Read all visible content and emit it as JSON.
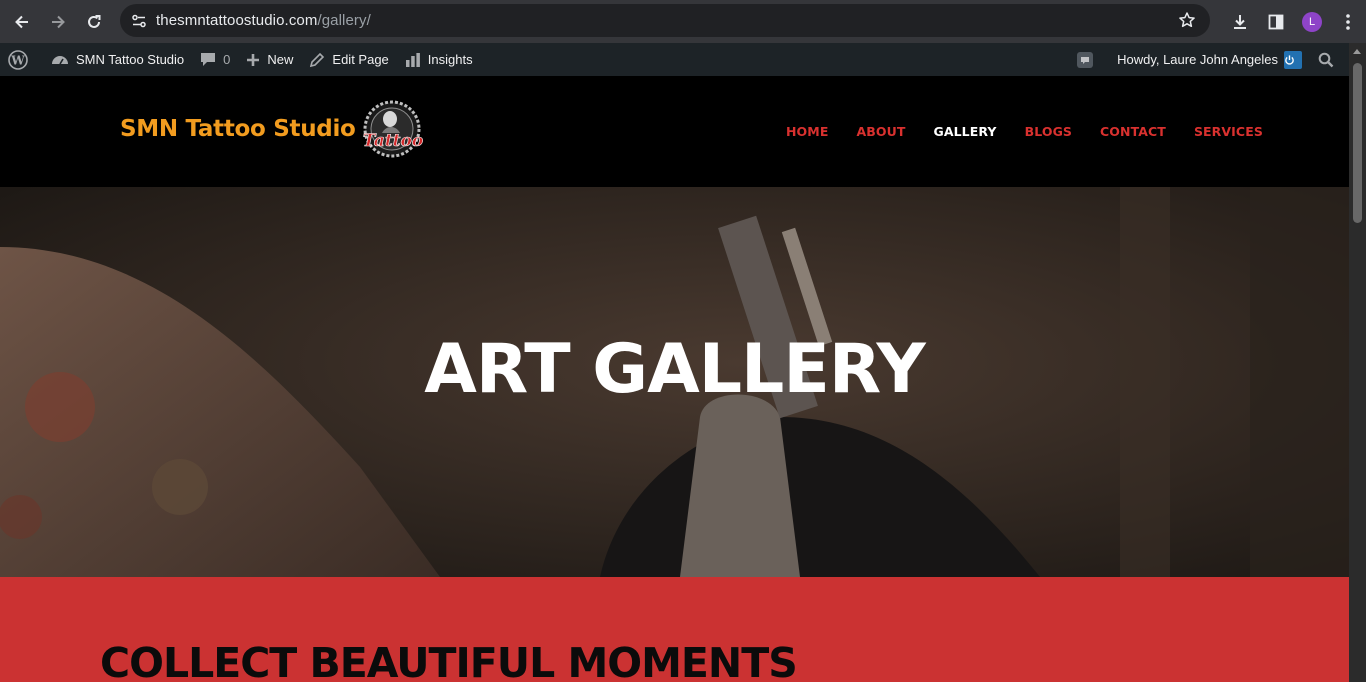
{
  "browser": {
    "url_host": "thesmntattoostudio.com",
    "url_path": "/gallery/",
    "profile_initial": "L"
  },
  "adminbar": {
    "site_name": "SMN Tattoo Studio",
    "comments_count": "0",
    "new_label": "New",
    "edit_label": "Edit Page",
    "insights_label": "Insights",
    "howdy": "Howdy, Laure John Angeles"
  },
  "header": {
    "brand": "SMN Tattoo Studio",
    "menu": [
      {
        "label": "HOME"
      },
      {
        "label": "ABOUT"
      },
      {
        "label": "GALLERY"
      },
      {
        "label": "BLOGS"
      },
      {
        "label": "CONTACT"
      },
      {
        "label": "SERVICES"
      }
    ]
  },
  "hero": {
    "title": "ART GALLERY"
  },
  "section": {
    "title": "COLLECT BEAUTIFUL MOMENTS"
  },
  "colors": {
    "brand": "#f29c1f",
    "menu": "#d9312f",
    "menu_active": "#ffffff",
    "section_bg": "#cb3232"
  }
}
